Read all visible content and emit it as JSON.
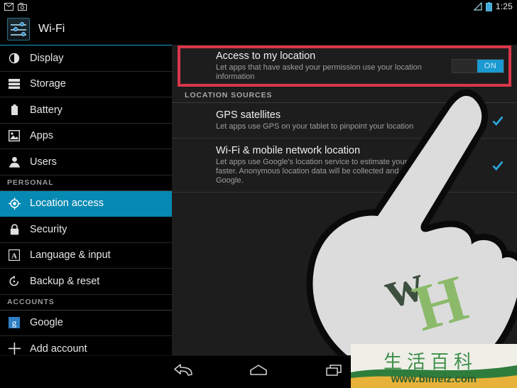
{
  "status_bar": {
    "notification_icons": [
      "mail-icon",
      "camera-icon"
    ],
    "signal_icon": "signal-triangle-icon",
    "battery_icon": "battery-icon",
    "clock": "1:25"
  },
  "header": {
    "icon": "wifi-settings-sliders-icon",
    "title": "Wi-Fi"
  },
  "sidebar": {
    "items": [
      {
        "label": "Display",
        "icon": "brightness-icon",
        "type": "item",
        "selected": false
      },
      {
        "label": "Storage",
        "icon": "storage-icon",
        "type": "item",
        "selected": false
      },
      {
        "label": "Battery",
        "icon": "battery-icon",
        "type": "item",
        "selected": false
      },
      {
        "label": "Apps",
        "icon": "apps-image-icon",
        "type": "item",
        "selected": false
      },
      {
        "label": "Users",
        "icon": "user-icon",
        "type": "item",
        "selected": false
      },
      {
        "label": "PERSONAL",
        "icon": "",
        "type": "header",
        "selected": false
      },
      {
        "label": "Location access",
        "icon": "location-target-icon",
        "type": "item",
        "selected": true
      },
      {
        "label": "Security",
        "icon": "lock-icon",
        "type": "item",
        "selected": false
      },
      {
        "label": "Language & input",
        "icon": "letter-a-icon",
        "type": "item",
        "selected": false
      },
      {
        "label": "Backup & reset",
        "icon": "restore-icon",
        "type": "item",
        "selected": false
      },
      {
        "label": "ACCOUNTS",
        "icon": "",
        "type": "header",
        "selected": false
      },
      {
        "label": "Google",
        "icon": "google-g-icon",
        "type": "item",
        "selected": false
      },
      {
        "label": "Add account",
        "icon": "plus-icon",
        "type": "item",
        "selected": false
      }
    ]
  },
  "main": {
    "master_switch": {
      "title": "Access to my location",
      "subtitle": "Let apps that have asked your permission use your location information",
      "toggle_label": "ON",
      "toggle_state": "on",
      "highlight_color": "#d9364a"
    },
    "section_header": "LOCATION SOURCES",
    "sources": [
      {
        "title": "GPS satellites",
        "subtitle": "Let apps use GPS on your tablet to pinpoint your location",
        "checked": true
      },
      {
        "title": "Wi-Fi & mobile network location",
        "subtitle": "Let apps use Google's location service to estimate your location faster. Anonymous location data will be collected and sent to Google.",
        "checked": true
      }
    ]
  },
  "nav_bar": {
    "buttons": [
      "back-icon",
      "home-icon",
      "recents-icon"
    ]
  },
  "overlay": {
    "hand_cursor": "pointing-hand-cursor",
    "hand_logo_1": "w",
    "hand_logo_2": "H"
  },
  "watermark": {
    "chinese_text": "生活百科",
    "url": "www.bimeiz.com"
  },
  "colors": {
    "accent_blue": "#0689b2",
    "toggle_blue": "#1a9ad0",
    "highlight_red": "#d9364a",
    "panel_bg": "#1d1d1d",
    "sidebar_bg": "#000000"
  }
}
